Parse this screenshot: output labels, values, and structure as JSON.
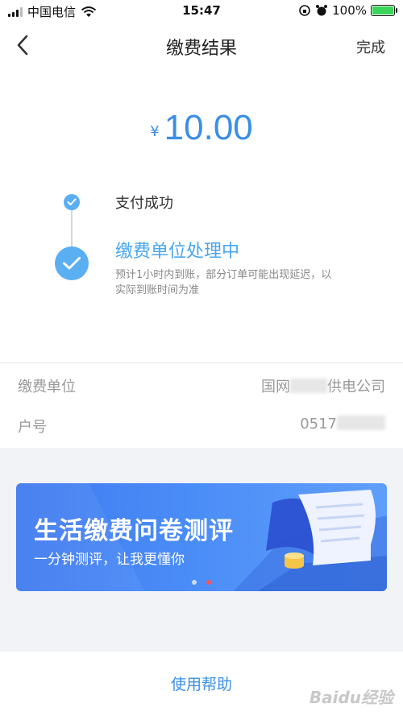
{
  "status_bar": {
    "carrier": "中国电信",
    "time": "15:47",
    "battery": "100%"
  },
  "nav": {
    "title": "缴费结果",
    "done_label": "完成"
  },
  "amount": {
    "currency": "¥",
    "value": "10.00"
  },
  "steps": [
    {
      "label": "支付成功"
    },
    {
      "label": "缴费单位处理中",
      "desc": "预计1小时内到账，部分订单可能出现延迟，以实际到账时间为准"
    }
  ],
  "info": {
    "unit_label": "缴费单位",
    "unit_value_prefix": "国网",
    "unit_value_suffix": "供电公司",
    "account_label": "户号",
    "account_value_prefix": "0517"
  },
  "banner": {
    "title": "生活缴费问卷测评",
    "subtitle": "一分钟测评，让我更懂你",
    "dots": 2,
    "active_dot": 1
  },
  "footer": {
    "help_label": "使用帮助"
  },
  "watermark": "Baidu经验",
  "colors": {
    "accent": "#3a8ee6",
    "step": "#5aaef2",
    "banner": "#4a8cf7",
    "dot_active": "#ff5252"
  }
}
